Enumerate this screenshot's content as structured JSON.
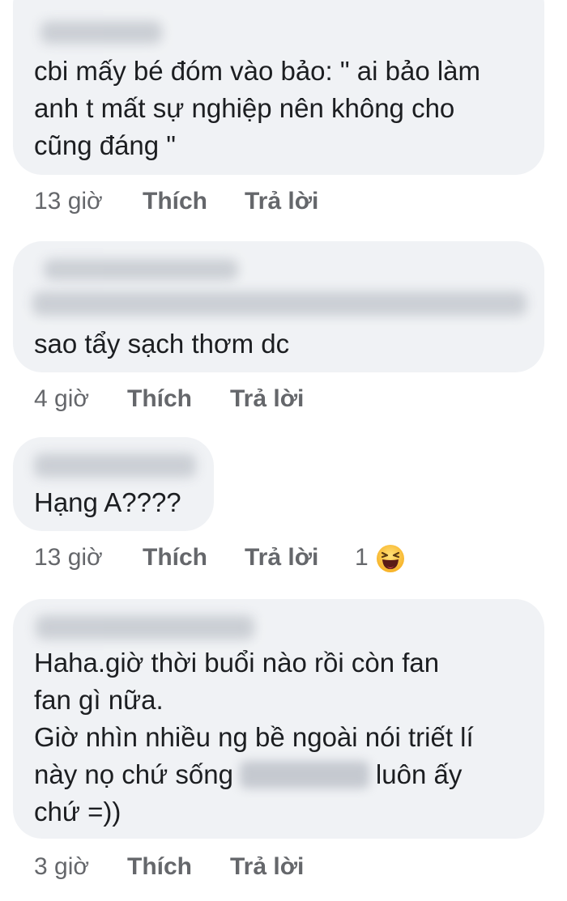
{
  "comments": [
    {
      "text": "cbi mấy bé đóm vào bảo: \" ai bảo làm\nanh t mất sự nghiệp nên không cho\ncũng đáng \"",
      "time": "13 giờ",
      "like_label": "Thích",
      "reply_label": "Trả lời"
    },
    {
      "text": "sao tẩy sạch thơm dc",
      "time": "4 giờ",
      "like_label": "Thích",
      "reply_label": "Trả lời"
    },
    {
      "text": "Hạng A????",
      "time": "13 giờ",
      "like_label": "Thích",
      "reply_label": "Trả lời",
      "reaction_count": "1",
      "reaction_icon": "haha-emoji-icon"
    },
    {
      "text_line1": "Haha.giờ thời buổi nào rồi còn fan",
      "text_line2": "fan gì nữa.",
      "text_line3": "Giờ nhìn nhiều ng bề ngoài nói triết lí",
      "text_line4a": "này nọ chứ sống",
      "text_line4b": "luôn ấy",
      "text_line5": "chứ =))",
      "time": "3 giờ",
      "like_label": "Thích",
      "reply_label": "Trả lời"
    }
  ],
  "colors": {
    "bubble": "#f0f2f5",
    "meta_text": "#65676b",
    "body_text": "#1c1e21"
  }
}
